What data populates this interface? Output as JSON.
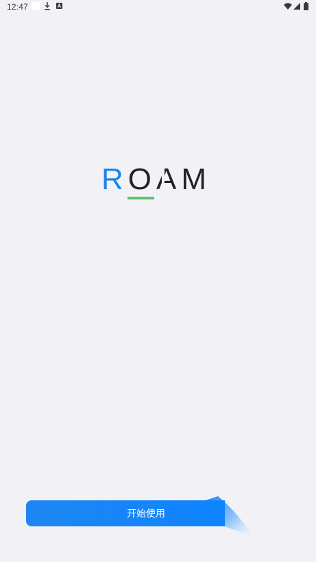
{
  "status_bar": {
    "time": "12:47",
    "notification_icons": [
      "blank-notification-icon",
      "download-icon",
      "app-notification-icon"
    ],
    "system_icons": [
      "wifi-icon",
      "cell-signal-icon",
      "battery-icon"
    ]
  },
  "logo": {
    "text_accent": "R",
    "text_rest": "OAM",
    "accent_color": "#1c86e6",
    "text_color": "#1f2326",
    "underline_color": "#5cc36a"
  },
  "start_button": {
    "label": "开始使用",
    "color": "#0f84ff"
  },
  "colors": {
    "background": "#f2f2f6"
  }
}
